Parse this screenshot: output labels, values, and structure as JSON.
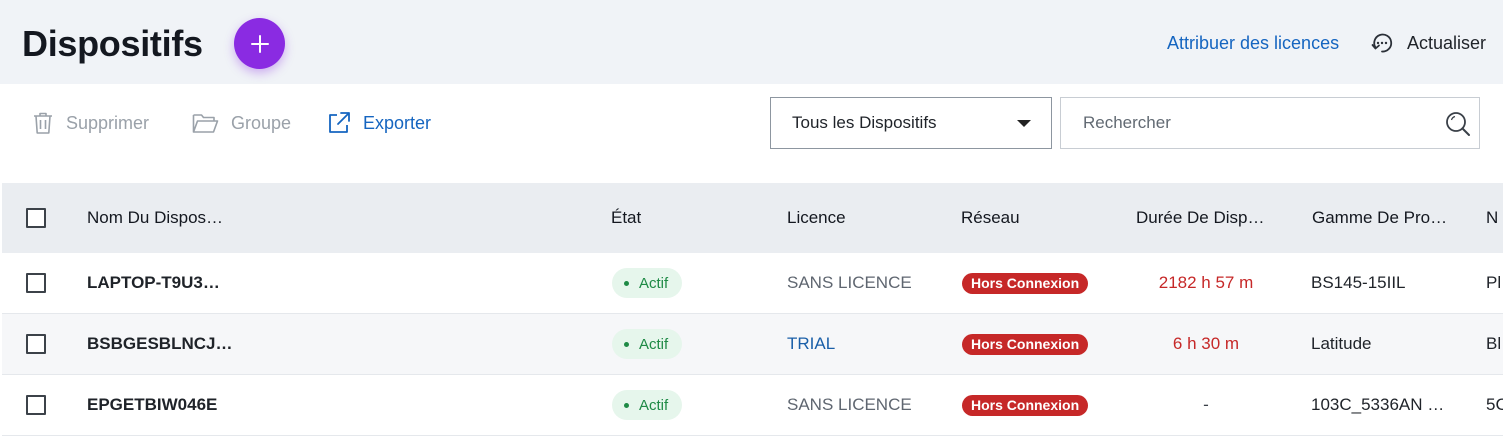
{
  "header": {
    "title": "Dispositifs",
    "add_icon": "plus-icon",
    "assign_link": "Attribuer des licences",
    "refresh_label": "Actualiser",
    "refresh_icon": "refresh-icon"
  },
  "toolbar": {
    "delete_label": "Supprimer",
    "group_label": "Groupe",
    "export_label": "Exporter",
    "filter_value": "Tous les Dispositifs",
    "search_placeholder": "Rechercher"
  },
  "colors": {
    "accent": "#8a2be2",
    "link": "#1565c0",
    "offline": "#c62828",
    "active_bg": "#e6f6ec",
    "active_fg": "#1e8a45"
  },
  "table": {
    "columns": [
      "Nom Du Dispos…",
      "État",
      "Licence",
      "Réseau",
      "Durée De Disp…",
      "Gamme De Pro…",
      "N"
    ],
    "rows": [
      {
        "name": "LAPTOP-T9U3…",
        "state": "Actif",
        "license": "SANS LICENCE",
        "network": "Hors Connexion",
        "duration": "2182 h 57 m",
        "range": "BS145-15IIL",
        "extra": "Pl"
      },
      {
        "name": "BSBGESBLNCJ…",
        "state": "Actif",
        "license": "TRIAL",
        "network": "Hors Connexion",
        "duration": "6 h 30 m",
        "range": "Latitude",
        "extra": "Bl"
      },
      {
        "name": "EPGETBIW046E",
        "state": "Actif",
        "license": "SANS LICENCE",
        "network": "Hors Connexion",
        "duration": "-",
        "range": "103C_5336AN …",
        "extra": "5C"
      }
    ]
  }
}
